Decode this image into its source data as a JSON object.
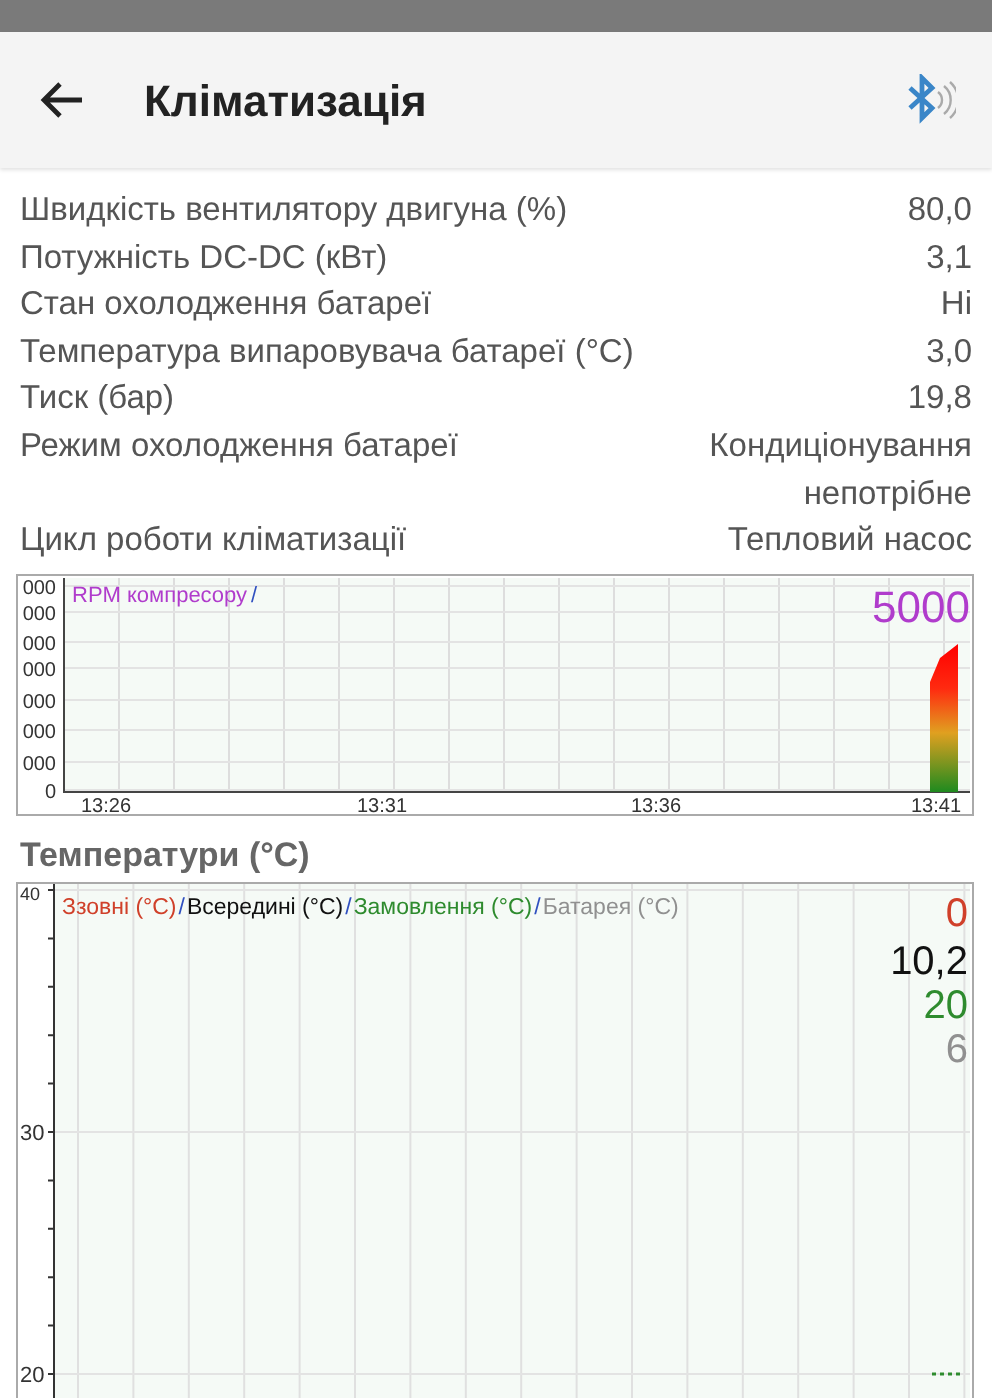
{
  "app_bar": {
    "title": "Кліматизація"
  },
  "rows": [
    {
      "label": "Швидкість вентилятору двигуна (%)",
      "value": "80,0"
    },
    {
      "label": "Потужність DC-DC (кВт)",
      "value": "3,1"
    },
    {
      "label": "Стан охолодження батареї",
      "value": "Ні"
    },
    {
      "label": "Температура випаровувача батареї (°C)",
      "value": "3,0"
    },
    {
      "label": "Тиск (бар)",
      "value": "19,8"
    },
    {
      "label": "Режим охолодження батареї",
      "value": "Кондиціонування непотрібне"
    },
    {
      "label": "Цикл роботи кліматизації",
      "value": "Тепловий насос"
    }
  ],
  "rpm_chart": {
    "legend": [
      {
        "label": "RPM компресору",
        "color": "#b03ccc"
      }
    ],
    "separator": "/",
    "current_value": "5000",
    "y_tick_labels": [
      "000",
      "000",
      "000",
      "000",
      "000",
      "000",
      "000",
      "0"
    ],
    "x_tick_labels": [
      "13:26",
      "13:31",
      "13:36",
      "13:41"
    ]
  },
  "temperature_section": {
    "title": "Температури (°C)",
    "separator": "/",
    "legend": [
      {
        "label": "Ззовні (°C)",
        "color": "#d0402a",
        "current_value": "0"
      },
      {
        "label": "Всередині (°C)",
        "color": "#111111",
        "current_value": "10,2"
      },
      {
        "label": "Замовлення (°C)",
        "color": "#2e8b2e",
        "current_value": "20"
      },
      {
        "label": "Батарея (°C)",
        "color": "#909090",
        "current_value": "6"
      }
    ],
    "y_tick_labels": [
      "40",
      "30",
      "20"
    ]
  }
}
